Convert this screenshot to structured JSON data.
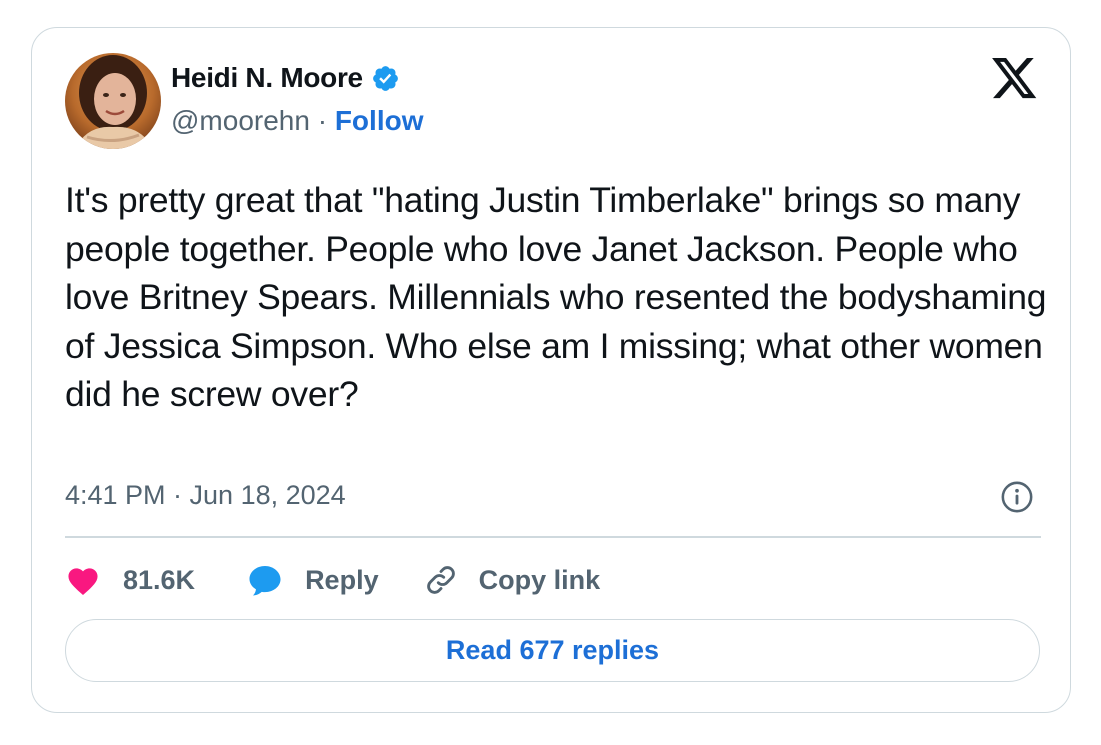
{
  "author": {
    "display_name": "Heidi N. Moore",
    "handle": "@moorehn",
    "separator": " · ",
    "follow_label": "Follow",
    "verified_icon": "verified-badge-icon",
    "verified_color": "#1d9bf0"
  },
  "platform_icon": "x-logo-icon",
  "tweet": {
    "text": "It's pretty great that \"hating Justin Timberlake\" brings so many people together. People who love Janet Jackson. People who love Britney Spears. Millennials who resented the bodyshaming of Jessica Simpson. Who else am I missing; what other women did he screw over?",
    "timestamp": "4:41 PM · Jun 18, 2024"
  },
  "actions": {
    "like_count": "81.6K",
    "reply_label": "Reply",
    "copy_link_label": "Copy link",
    "like_color": "#f91880",
    "reply_color": "#1d9bf0"
  },
  "read_replies_label": "Read 677 replies",
  "colors": {
    "link": "#1d6fd6",
    "muted": "#536471",
    "border": "#cfd9de"
  }
}
